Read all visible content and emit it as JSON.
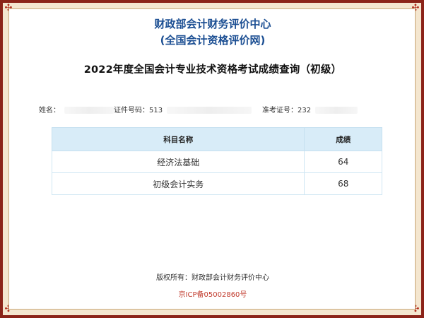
{
  "header": {
    "org_name": "财政部会计财务评价中心",
    "org_subtitle": "(全国会计资格评价网)"
  },
  "main": {
    "title": "2022年度全国会计专业技术资格考试成绩查询（初级）"
  },
  "candidate": {
    "name_label": "姓名：",
    "id_label": "证件号码：513",
    "exam_label": "准考证号：232"
  },
  "table": {
    "headers": {
      "subject": "科目名称",
      "score": "成绩"
    },
    "rows": [
      {
        "subject": "经济法基础",
        "score": "64"
      },
      {
        "subject": "初级会计实务",
        "score": "68"
      }
    ]
  },
  "footer": {
    "copyright": "版权所有：财政部会计财务评价中心",
    "icp": "京ICP备05002860号"
  },
  "colors": {
    "border": "#8b2318",
    "title_blue": "#1c4f93",
    "table_header": "#d8ecf8",
    "icp_red": "#c0392b"
  }
}
